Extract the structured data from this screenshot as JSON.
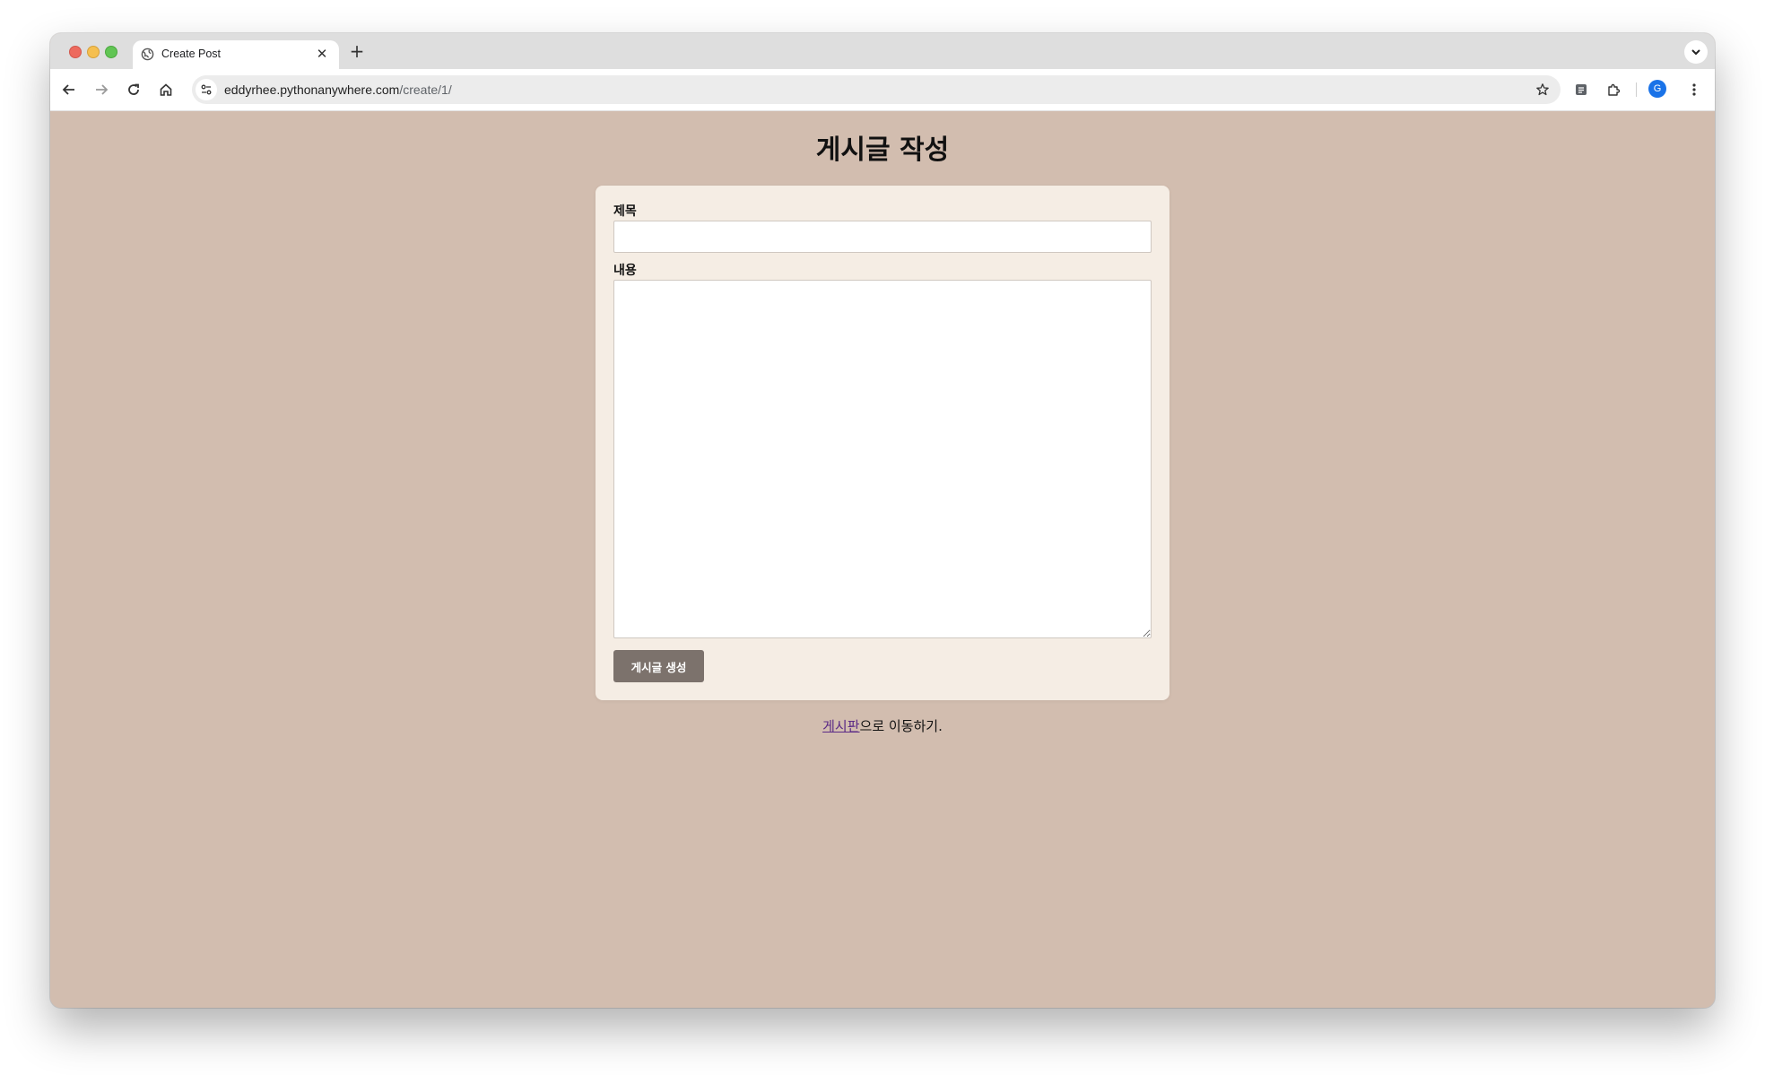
{
  "browser": {
    "tab": {
      "title": "Create Post",
      "close_glyph": "✕"
    },
    "new_tab_glyph": "+",
    "url": {
      "host": "eddyrhee.pythonanywhere.com",
      "path": "/create/1/"
    },
    "profile_initial": "G"
  },
  "page": {
    "heading": "게시글 작성",
    "form": {
      "title_label": "제목",
      "title_value": "",
      "content_label": "내용",
      "content_value": "",
      "submit_label": "게시글 생성"
    },
    "footer": {
      "link_text": "게시판",
      "suffix_text": "으로 이동하기."
    }
  },
  "colors": {
    "page_background": "#d2bdaf",
    "card_background": "#f5ede4",
    "button_background": "#7c726c",
    "link_color": "#5b2a86"
  },
  "icons": {
    "tab_favicon": "globe-icon",
    "back": "arrow-left-icon",
    "forward": "arrow-right-icon",
    "reload": "reload-icon",
    "home": "home-icon",
    "site_info": "tune-icon",
    "bookmark": "star-icon",
    "reading_mode": "reading-mode-icon",
    "extensions": "puzzle-icon",
    "menu": "kebab-menu-icon",
    "tab_search": "chevron-down-icon"
  }
}
